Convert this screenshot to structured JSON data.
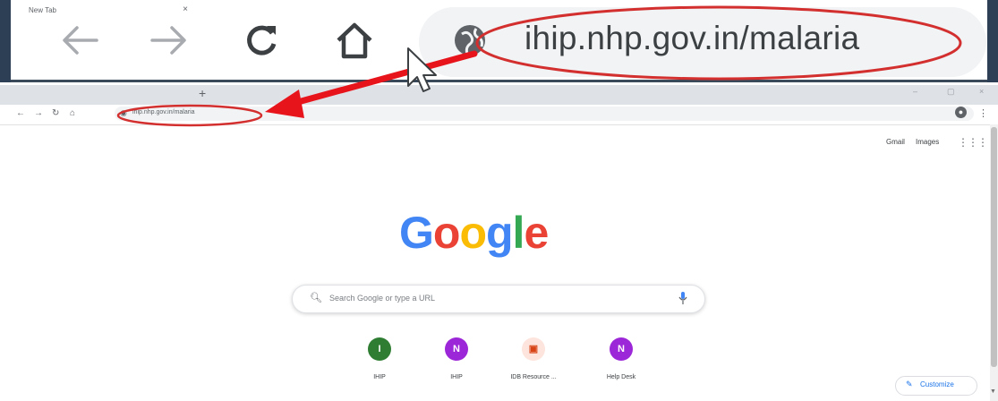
{
  "zoom_toolbar": {
    "url": "ihip.nhp.gov.in/malaria",
    "buttons": [
      "back-icon",
      "forward-icon",
      "reload-icon",
      "home-icon"
    ]
  },
  "browser": {
    "tab_title": "New Tab",
    "tab_close": "×",
    "new_tab": "+",
    "url": "ihip.nhp.gov.in/malaria",
    "window_controls": [
      "–",
      "▢",
      "×"
    ]
  },
  "newtab_page": {
    "top_links": [
      "Gmail",
      "Images"
    ],
    "logo_letters": [
      {
        "char": "G",
        "color": "#4285F4"
      },
      {
        "char": "o",
        "color": "#EA4335"
      },
      {
        "char": "o",
        "color": "#FBBC05"
      },
      {
        "char": "g",
        "color": "#4285F4"
      },
      {
        "char": "l",
        "color": "#34A853"
      },
      {
        "char": "e",
        "color": "#EA4335"
      }
    ],
    "search_placeholder": "Search Google or type a URL",
    "shortcuts": [
      {
        "label": "IHIP",
        "letter": "I",
        "color": "#2e7d32"
      },
      {
        "label": "IHIP",
        "letter": "N",
        "color": "#9c27d8"
      },
      {
        "label": "IDB Resource ...",
        "letter": "▣",
        "color": "#f2b8a8"
      },
      {
        "label": "Help Desk",
        "letter": "N",
        "color": "#9c27d8"
      }
    ],
    "customize_label": "Customize"
  },
  "annotation": {
    "highlight_color": "#d32f2f",
    "arrow_color": "#e8141c"
  }
}
